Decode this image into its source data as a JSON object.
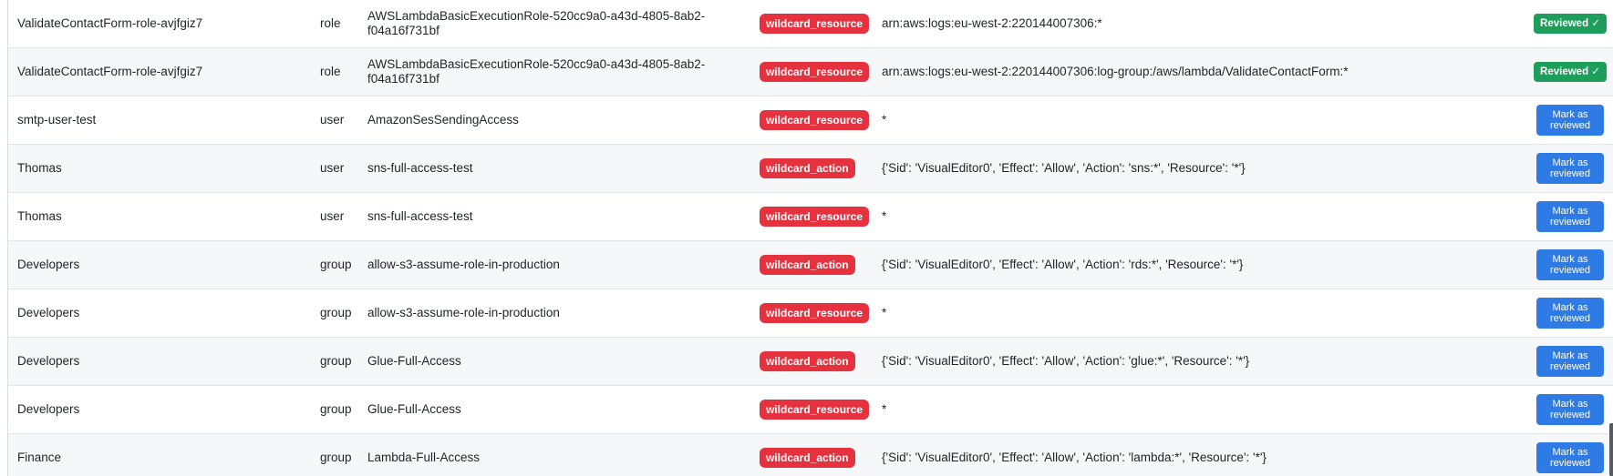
{
  "findings": [
    {
      "entity": "ValidateContactForm-role-avjfgiz7",
      "type": "role",
      "policy": "AWSLambdaBasicExecutionRole-520cc9a0-a43d-4805-8ab2-f04a16f731bf",
      "issue": "wildcard_resource",
      "detail": "arn:aws:logs:eu-west-2:220144007306:*",
      "action": "Reviewed ✓"
    },
    {
      "entity": "ValidateContactForm-role-avjfgiz7",
      "type": "role",
      "policy": "AWSLambdaBasicExecutionRole-520cc9a0-a43d-4805-8ab2-f04a16f731bf",
      "issue": "wildcard_resource",
      "detail": "arn:aws:logs:eu-west-2:220144007306:log-group:/aws/lambda/ValidateContactForm:*",
      "action": "Reviewed ✓"
    },
    {
      "entity": "smtp-user-test",
      "type": "user",
      "policy": "AmazonSesSendingAccess",
      "issue": "wildcard_resource",
      "detail": "*",
      "action": "Mark as reviewed"
    },
    {
      "entity": "Thomas",
      "type": "user",
      "policy": "sns-full-access-test",
      "issue": "wildcard_action",
      "detail": "{'Sid': 'VisualEditor0', 'Effect': 'Allow', 'Action': 'sns:*', 'Resource': '*'}",
      "action": "Mark as reviewed"
    },
    {
      "entity": "Thomas",
      "type": "user",
      "policy": "sns-full-access-test",
      "issue": "wildcard_resource",
      "detail": "*",
      "action": "Mark as reviewed"
    },
    {
      "entity": "Developers",
      "type": "group",
      "policy": "allow-s3-assume-role-in-production",
      "issue": "wildcard_action",
      "detail": "{'Sid': 'VisualEditor0', 'Effect': 'Allow', 'Action': 'rds:*', 'Resource': '*'}",
      "action": "Mark as reviewed"
    },
    {
      "entity": "Developers",
      "type": "group",
      "policy": "allow-s3-assume-role-in-production",
      "issue": "wildcard_resource",
      "detail": "*",
      "action": "Mark as reviewed"
    },
    {
      "entity": "Developers",
      "type": "group",
      "policy": "Glue-Full-Access",
      "issue": "wildcard_action",
      "detail": "{'Sid': 'VisualEditor0', 'Effect': 'Allow', 'Action': 'glue:*', 'Resource': '*'}",
      "action": "Mark as reviewed"
    },
    {
      "entity": "Developers",
      "type": "group",
      "policy": "Glue-Full-Access",
      "issue": "wildcard_resource",
      "detail": "*",
      "action": "Mark as reviewed"
    },
    {
      "entity": "Finance",
      "type": "group",
      "policy": "Lambda-Full-Access",
      "issue": "wildcard_action",
      "detail": "{'Sid': 'VisualEditor0', 'Effect': 'Allow', 'Action': 'lambda:*', 'Resource': '*'}",
      "action": "Mark as reviewed"
    }
  ],
  "colors": {
    "issue_badge": "#e5323e",
    "reviewed_badge": "#1e9e5b",
    "mark_button": "#2f7be5",
    "row_alt": "#f6f7f9"
  }
}
